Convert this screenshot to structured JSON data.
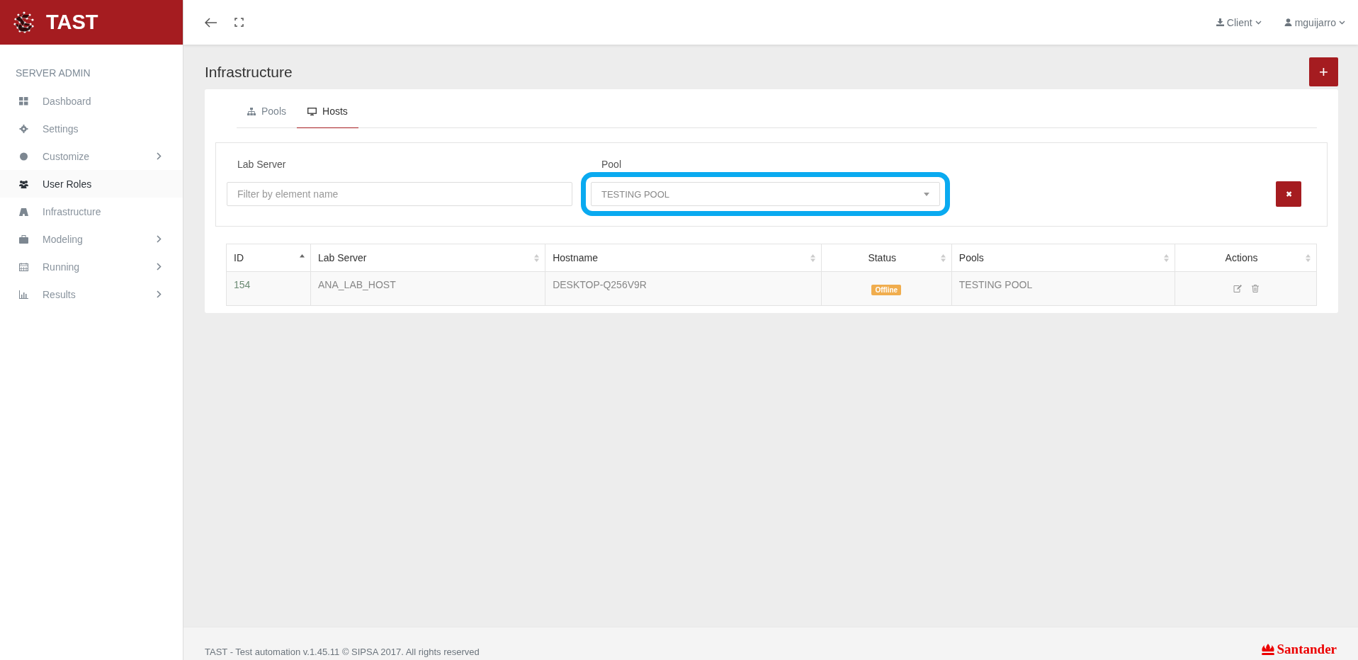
{
  "brand": {
    "name": "TAST"
  },
  "topbar": {
    "menus": [
      {
        "kind": "download",
        "label": "Client"
      },
      {
        "kind": "user",
        "label": "mguijarro"
      }
    ]
  },
  "sidebar": {
    "heading": "SERVER ADMIN",
    "items": [
      {
        "label": "Dashboard",
        "selected": false,
        "submenu": false
      },
      {
        "label": "Settings",
        "selected": false,
        "submenu": false
      },
      {
        "label": "Customize",
        "selected": false,
        "submenu": true
      },
      {
        "label": "User Roles",
        "selected": true,
        "submenu": false
      },
      {
        "label": "Infrastructure",
        "selected": false,
        "submenu": false
      },
      {
        "label": "Modeling",
        "selected": false,
        "submenu": true
      },
      {
        "label": "Running",
        "selected": false,
        "submenu": true
      },
      {
        "label": "Results",
        "selected": false,
        "submenu": true
      }
    ]
  },
  "page": {
    "title": "Infrastructure",
    "add_button": "+"
  },
  "tabs": [
    {
      "label": "Pools",
      "selected": false
    },
    {
      "label": "Hosts",
      "selected": true
    }
  ],
  "filters": {
    "lab_server": {
      "label": "Lab Server",
      "placeholder": "Filter by element name"
    },
    "pool": {
      "label": "Pool",
      "value": "TESTING POOL",
      "highlighted": true
    },
    "clear_button": "✖"
  },
  "table": {
    "columns": [
      {
        "label": "ID",
        "sorted": true
      },
      {
        "label": "Lab Server",
        "sorted": false
      },
      {
        "label": "Hostname",
        "sorted": false
      },
      {
        "label": "Status",
        "sorted": false
      },
      {
        "label": "Pools",
        "sorted": false
      },
      {
        "label": "Actions",
        "sorted": false
      }
    ],
    "rows": [
      {
        "id": "154",
        "lab_server": "ANA_LAB_HOST",
        "hostname": "DESKTOP-Q256V9R",
        "status": {
          "label": "Offline",
          "color": "#f0ad4e"
        },
        "pools": "TESTING POOL"
      }
    ]
  },
  "footer": {
    "text": "TAST - Test automation v.1.45.11 © SIPSA 2017. All rights reserved",
    "logo": "Santander"
  }
}
